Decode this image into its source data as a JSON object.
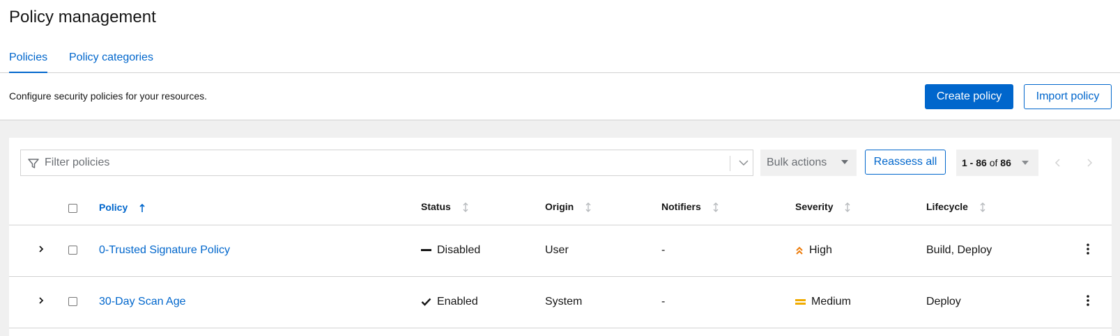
{
  "page": {
    "title": "Policy management"
  },
  "tabs": [
    {
      "label": "Policies",
      "active": true
    },
    {
      "label": "Policy categories",
      "active": false
    }
  ],
  "description": "Configure security policies for your resources.",
  "actions": {
    "create": "Create policy",
    "import": "Import policy"
  },
  "toolbar": {
    "filter_placeholder": "Filter policies",
    "bulk_actions": "Bulk actions",
    "reassess": "Reassess all",
    "pagination": {
      "range": "1 - 86",
      "of": "of",
      "total": "86"
    }
  },
  "table": {
    "columns": {
      "policy": "Policy",
      "status": "Status",
      "origin": "Origin",
      "notifiers": "Notifiers",
      "severity": "Severity",
      "lifecycle": "Lifecycle"
    },
    "rows": [
      {
        "policy": "0-Trusted Signature Policy",
        "status": "Disabled",
        "status_icon": "minus-icon",
        "origin": "User",
        "notifiers": "-",
        "severity": "High",
        "severity_icon": "angle-double-up-icon",
        "severity_color": "#ec7a08",
        "lifecycle": "Build, Deploy"
      },
      {
        "policy": "30-Day Scan Age",
        "status": "Enabled",
        "status_icon": "check-icon",
        "origin": "System",
        "notifiers": "-",
        "severity": "Medium",
        "severity_icon": "equals-icon",
        "severity_color": "#f0ab00",
        "lifecycle": "Deploy"
      }
    ]
  },
  "colors": {
    "accent": "#0066cc",
    "border": "#d2d2d2",
    "background": "#f0f0f0"
  }
}
